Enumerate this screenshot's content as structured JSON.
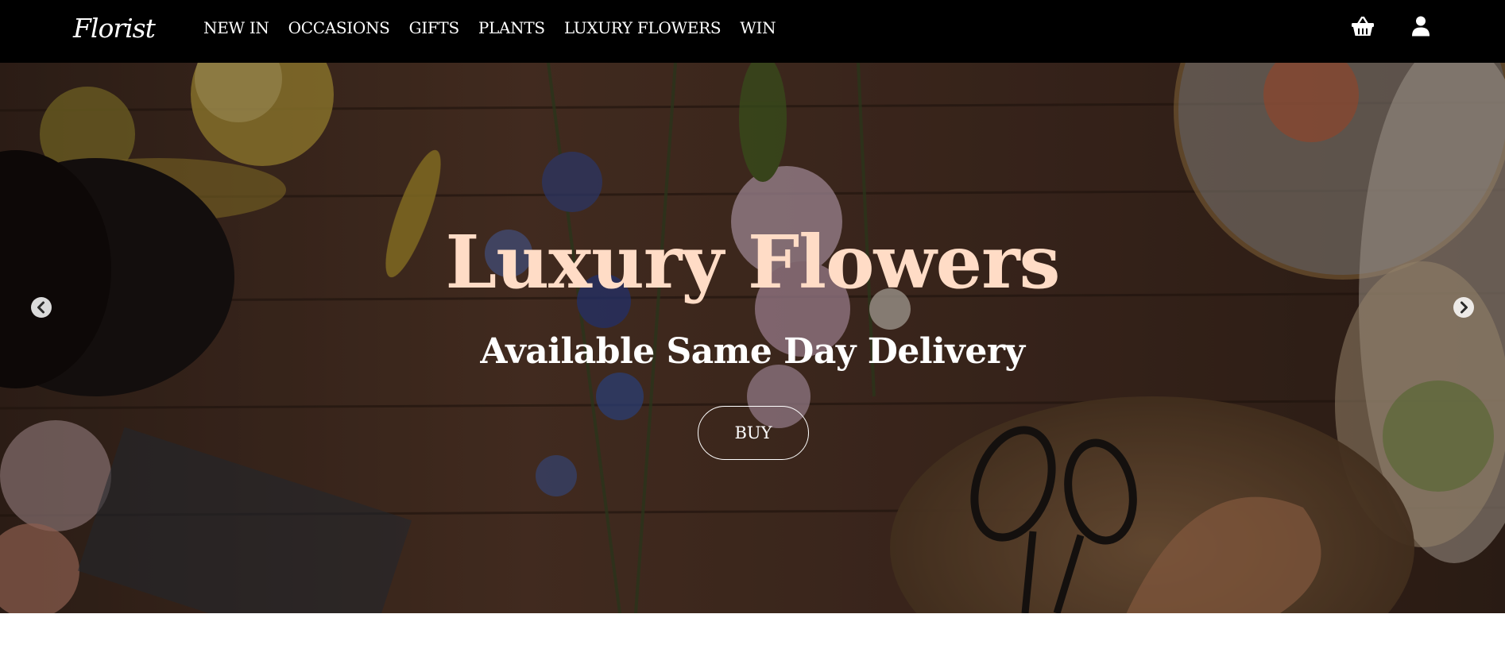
{
  "brand": {
    "logo_text": "Florist"
  },
  "nav": {
    "links": [
      "NEW IN",
      "OCCASIONS",
      "GIFTS",
      "PLANTS",
      "LUXURY FLOWERS",
      "WIN"
    ],
    "icons": [
      "basket-icon",
      "user-icon"
    ]
  },
  "hero": {
    "title": "Luxury Flowers",
    "subtitle": "Available Same Day Delivery",
    "button_label": "BUY",
    "prev_icon": "chevron-left-circle-icon",
    "next_icon": "chevron-right-circle-icon"
  },
  "colors": {
    "navbar_bg": "#000000",
    "nav_text": "#ffffff",
    "hero_title": "#ffdcc6",
    "hero_subtitle": "#ffffff",
    "hero_wood": "#4a3023"
  }
}
